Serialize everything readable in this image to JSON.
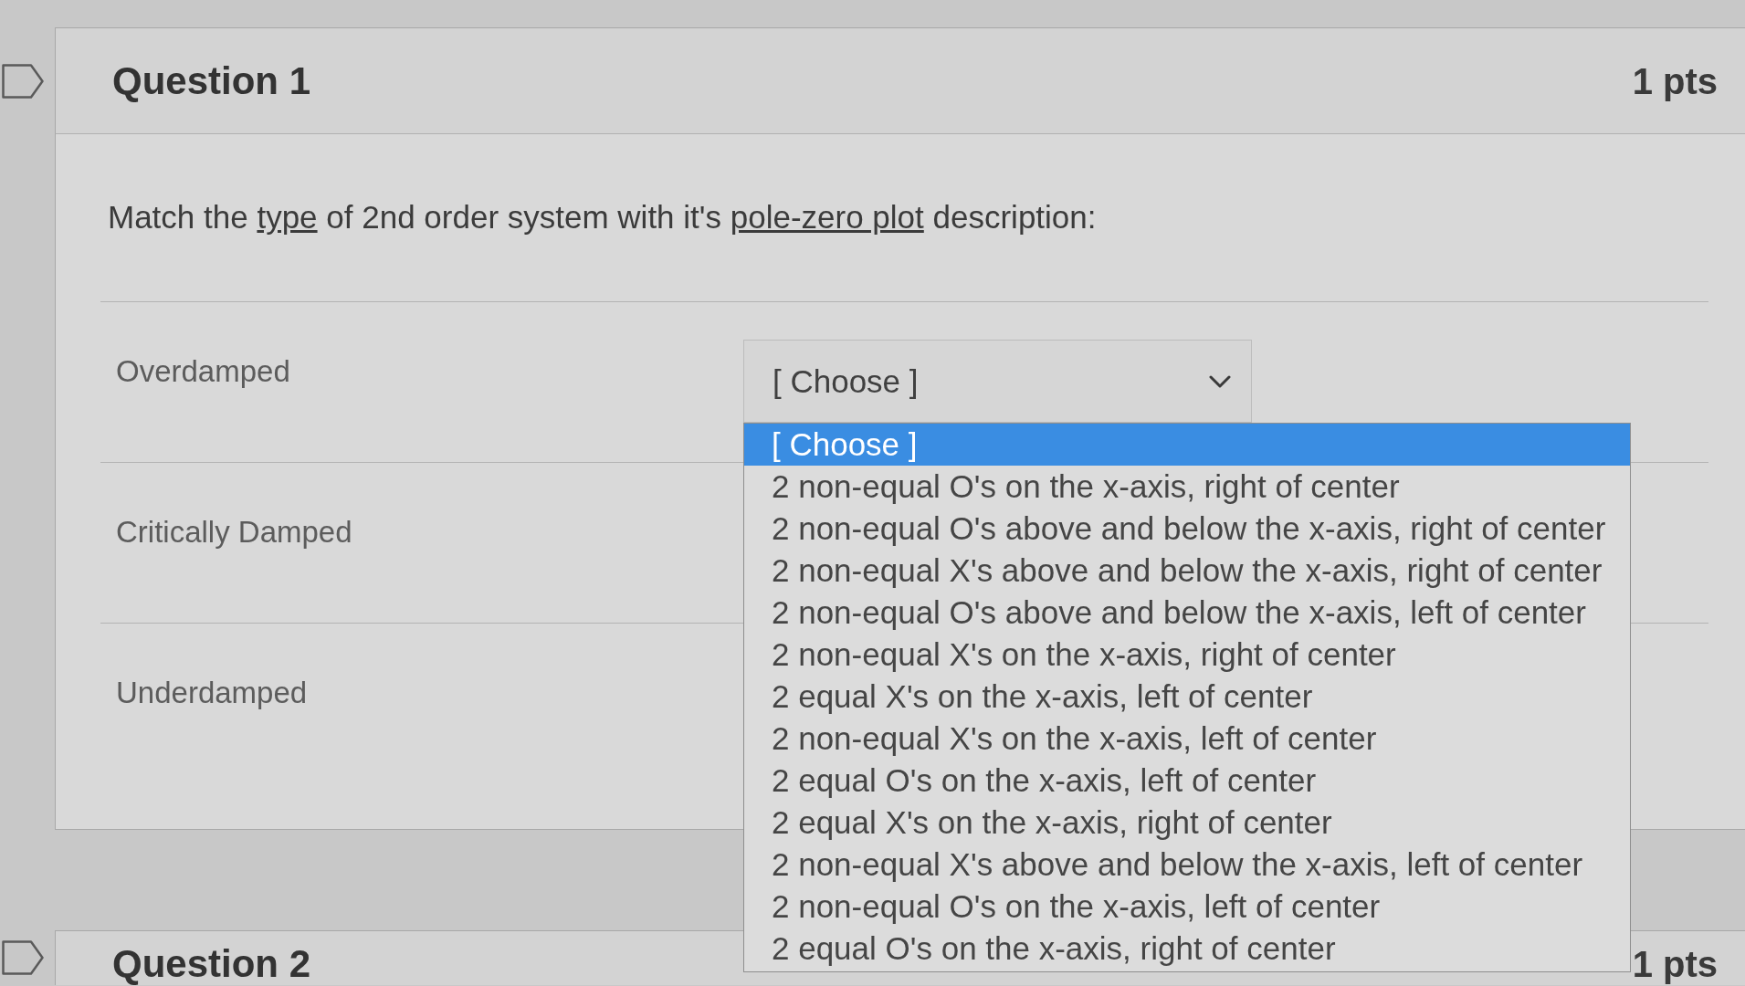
{
  "questions": [
    {
      "title": "Question 1",
      "points": "1 pts",
      "flagged": false,
      "prompt": [
        {
          "kind": "text",
          "text": "Match the "
        },
        {
          "kind": "link",
          "text": "type"
        },
        {
          "kind": "text",
          "text": " of 2nd order system with it's "
        },
        {
          "kind": "link",
          "text": "pole-zero plot"
        },
        {
          "kind": "text",
          "text": " description:"
        }
      ],
      "matches": [
        {
          "label": "Overdamped",
          "select": {
            "value": "[ Choose ]",
            "expanded": true,
            "options": [
              {
                "label": "[ Choose ]",
                "selected": true
              },
              {
                "label": "2 non-equal O's on the x-axis, right of center",
                "selected": false
              },
              {
                "label": "2 non-equal O's above and below the x-axis, right of center",
                "selected": false
              },
              {
                "label": "2 non-equal X's above and below the x-axis, right of center",
                "selected": false
              },
              {
                "label": "2 non-equal O's above and below the x-axis, left of center",
                "selected": false
              },
              {
                "label": "2 non-equal X's on the x-axis, right of center",
                "selected": false
              },
              {
                "label": "2 equal X's on the x-axis, left of center",
                "selected": false
              },
              {
                "label": "2 non-equal X's on the x-axis, left of center",
                "selected": false
              },
              {
                "label": "2 equal O's on the x-axis, left of center",
                "selected": false
              },
              {
                "label": "2 equal X's on the x-axis, right of center",
                "selected": false
              },
              {
                "label": "2 non-equal X's above and below the x-axis, left of center",
                "selected": false
              },
              {
                "label": "2 non-equal O's on the x-axis, left of center",
                "selected": false
              },
              {
                "label": "2 equal O's on the x-axis, right of center",
                "selected": false
              }
            ]
          }
        },
        {
          "label": "Critically Damped"
        },
        {
          "label": "Underdamped"
        }
      ]
    },
    {
      "title": "Question 2",
      "points": "1 pts",
      "flagged": false
    }
  ]
}
